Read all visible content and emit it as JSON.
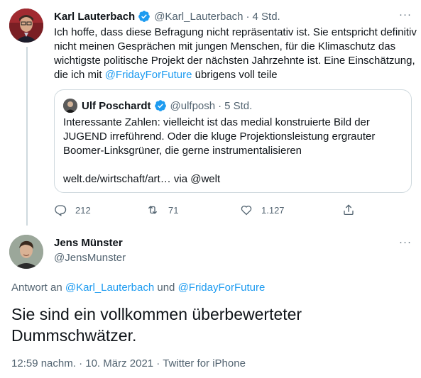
{
  "main_tweet": {
    "name": "Karl Lauterbach",
    "handle": "@Karl_Lauterbach",
    "separator": "·",
    "time": "4 Std.",
    "text_lines": [
      "Ich hoffe, dass diese Befragung nicht repräsentativ ist. Sie entspricht definitiv",
      "nicht meinen Gesprächen mit jungen Menschen, für die Klimaschutz das",
      "wichtigste politische Projekt der nächsten Jahrzehnte ist. Eine Einschätzung,"
    ],
    "last_line_pre": "die ich mit ",
    "last_line_link": "@FridayForFuture",
    "last_line_post": " übrigens voll teile",
    "more": "···"
  },
  "quote_tweet": {
    "name": "Ulf Poschardt",
    "handle": "@ulfposh",
    "separator": "·",
    "time": "5 Std.",
    "text_lines": [
      "Interessante Zahlen: vielleicht ist das medial konstruierte Bild der",
      "JUGEND irreführend. Oder die kluge Projektionsleistung ergrauter",
      "Boomer-Linksgrüner, die gerne instrumentalisieren"
    ],
    "link_line": "welt.de/wirtschaft/art… via @welt"
  },
  "actions": {
    "replies": "212",
    "retweets": "71",
    "likes": "1.127"
  },
  "reply_tweet": {
    "name": "Jens Münster",
    "handle": "@JensMunster",
    "more": "···",
    "reply_to_label": "Antwort an ",
    "reply_to_user1": "@Karl_Lauterbach",
    "reply_to_and": " und ",
    "reply_to_user2": "@FridayForFuture",
    "text_line1": "Sie sind ein vollkommen überbewerteter",
    "text_line2": "Dummschwätzer.",
    "meta_time": "12:59 nachm.",
    "meta_sep1": " · ",
    "meta_date": "10. März 2021",
    "meta_sep2": " · ",
    "meta_source": "Twitter for iPhone"
  },
  "colors": {
    "link": "#1d9bf0",
    "muted": "#536471",
    "text": "#0f1419",
    "border": "#cfd9de"
  }
}
